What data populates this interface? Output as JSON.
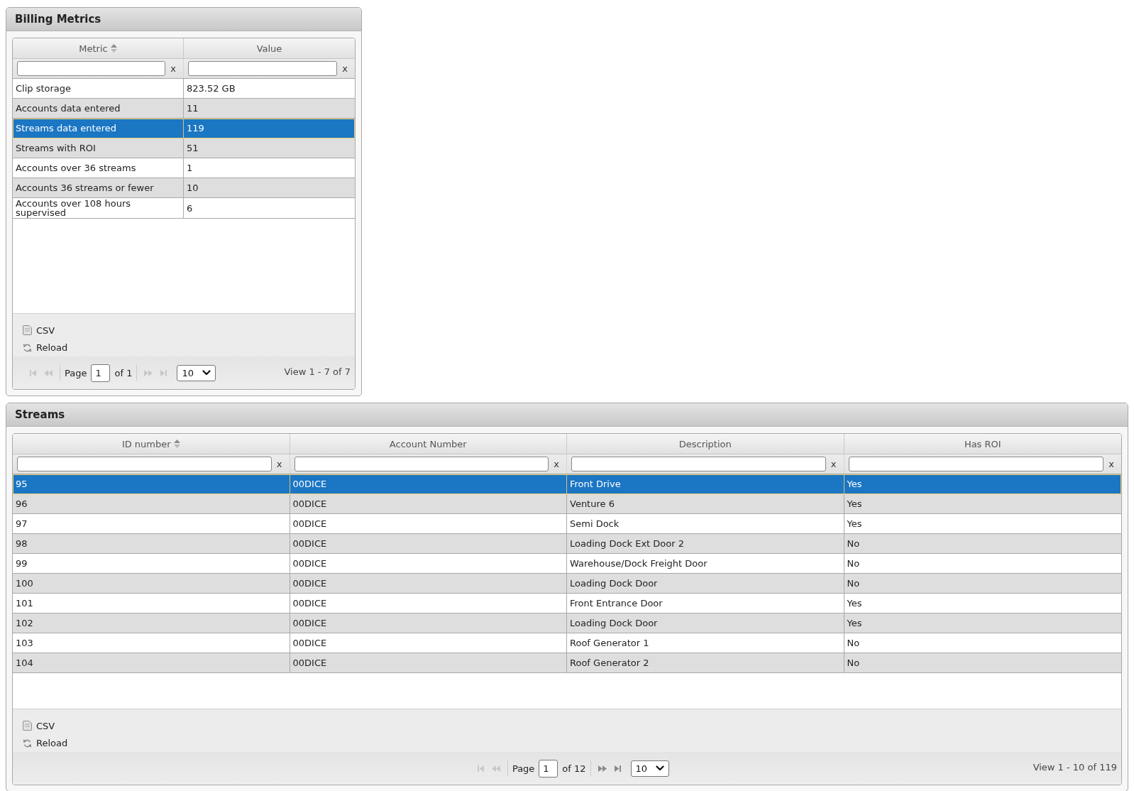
{
  "panels": [
    {
      "title": "Billing Metrics",
      "columns": [
        {
          "label": "Metric",
          "sorted": true
        },
        {
          "label": "Value",
          "sorted": false
        }
      ],
      "filters": [
        {
          "clear": "x"
        },
        {
          "clear": "x"
        }
      ],
      "rows": [
        {
          "cells": [
            "Clip storage",
            "823.52 GB"
          ],
          "selected": false
        },
        {
          "cells": [
            "Accounts data entered",
            "11"
          ],
          "selected": false
        },
        {
          "cells": [
            "Streams data entered",
            "119"
          ],
          "selected": true
        },
        {
          "cells": [
            "Streams with ROI",
            "51"
          ],
          "selected": false
        },
        {
          "cells": [
            "Accounts over 36 streams",
            "1"
          ],
          "selected": false
        },
        {
          "cells": [
            "Accounts 36 streams or fewer",
            "10"
          ],
          "selected": false
        },
        {
          "cells": [
            "Accounts over 108 hours supervised",
            "6"
          ],
          "selected": false
        }
      ],
      "actions": [
        {
          "kind": "csv",
          "label": "CSV"
        },
        {
          "kind": "reload",
          "label": "Reload"
        }
      ],
      "pager": {
        "buttons": [
          {
            "kind": "first",
            "disabled": true
          },
          {
            "kind": "prev",
            "disabled": true
          },
          {
            "kind": "next",
            "disabled": true
          },
          {
            "kind": "last",
            "disabled": true
          }
        ],
        "page_label": "Page",
        "page": "1",
        "total": "of 1",
        "page_size": "10",
        "summary": "View 1 - 7 of 7"
      }
    },
    {
      "title": "Streams",
      "columns": [
        {
          "label": "ID number",
          "sorted": true
        },
        {
          "label": "Account Number",
          "sorted": false
        },
        {
          "label": "Description",
          "sorted": false
        },
        {
          "label": "Has ROI",
          "sorted": false
        }
      ],
      "filters": [
        {
          "clear": "x"
        },
        {
          "clear": "x"
        },
        {
          "clear": "x"
        },
        {
          "clear": "x"
        }
      ],
      "rows": [
        {
          "cells": [
            "95",
            "00DICE",
            "Front Drive",
            "Yes"
          ],
          "selected": true
        },
        {
          "cells": [
            "96",
            "00DICE",
            "Venture 6",
            "Yes"
          ],
          "selected": false
        },
        {
          "cells": [
            "97",
            "00DICE",
            "Semi Dock",
            "Yes"
          ],
          "selected": false
        },
        {
          "cells": [
            "98",
            "00DICE",
            "Loading Dock Ext Door 2",
            "No"
          ],
          "selected": false
        },
        {
          "cells": [
            "99",
            "00DICE",
            "Warehouse/Dock Freight Door",
            "No"
          ],
          "selected": false
        },
        {
          "cells": [
            "100",
            "00DICE",
            "Loading Dock Door",
            "No"
          ],
          "selected": false
        },
        {
          "cells": [
            "101",
            "00DICE",
            "Front Entrance Door",
            "Yes"
          ],
          "selected": false
        },
        {
          "cells": [
            "102",
            "00DICE",
            "Loading Dock Door",
            "Yes"
          ],
          "selected": false
        },
        {
          "cells": [
            "103",
            "00DICE",
            "Roof Generator 1",
            "No"
          ],
          "selected": false
        },
        {
          "cells": [
            "104",
            "00DICE",
            "Roof Generator 2",
            "No"
          ],
          "selected": false
        }
      ],
      "actions": [
        {
          "kind": "csv",
          "label": "CSV"
        },
        {
          "kind": "reload",
          "label": "Reload"
        }
      ],
      "pager": {
        "buttons": [
          {
            "kind": "first",
            "disabled": true
          },
          {
            "kind": "prev",
            "disabled": true
          },
          {
            "kind": "next",
            "disabled": false
          },
          {
            "kind": "last",
            "disabled": false
          }
        ],
        "page_label": "Page",
        "page": "1",
        "total": "of 12",
        "page_size": "10",
        "summary": "View 1 - 10 of 119"
      }
    }
  ]
}
